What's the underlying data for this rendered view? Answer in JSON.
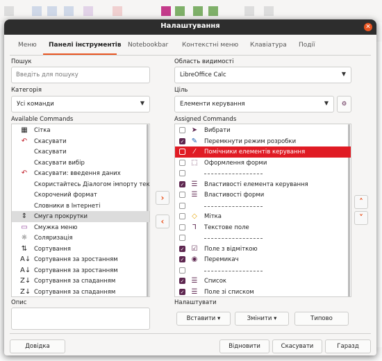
{
  "dialog": {
    "title": "Налаштування",
    "close_icon": "close-icon"
  },
  "tabs": [
    {
      "label": "Меню"
    },
    {
      "label": "Панелі інструментів"
    },
    {
      "label": "Notebookbar"
    },
    {
      "label": "Контекстні меню"
    },
    {
      "label": "Клавіатура"
    },
    {
      "label": "Події"
    }
  ],
  "left": {
    "search_label": "Пошук",
    "search_placeholder": "Введіть для пошуку",
    "category_label": "Категорія",
    "category_value": "Усі команди",
    "available_label": "Available Commands",
    "commands": [
      {
        "icon": "grid-icon",
        "glyph": "▦",
        "label": "Сітка"
      },
      {
        "icon": "undo-icon",
        "glyph": "↶",
        "label": "Скасувати"
      },
      {
        "icon": "",
        "glyph": "",
        "label": "Скасувати"
      },
      {
        "icon": "",
        "glyph": "",
        "label": "Скасувати вибір"
      },
      {
        "icon": "undo-icon",
        "glyph": "↶",
        "label": "Скасувати: введення даних"
      },
      {
        "icon": "",
        "glyph": "",
        "label": "Скористайтесь Діалогом імпорту тексту"
      },
      {
        "icon": "",
        "glyph": "",
        "label": "Скорочений формат"
      },
      {
        "icon": "",
        "glyph": "",
        "label": "Словники в Інтернеті"
      },
      {
        "icon": "scrollbar-icon",
        "glyph": "⇕",
        "label": "Смуга прокрутки"
      },
      {
        "icon": "menubar-icon",
        "glyph": "▭",
        "label": "Смужка меню"
      },
      {
        "icon": "solarize-icon",
        "glyph": "☼",
        "label": "Соляризація"
      },
      {
        "icon": "sort-icon",
        "glyph": "⇅",
        "label": "Сортування"
      },
      {
        "icon": "sort-ascending-icon",
        "glyph": "A↓",
        "label": "Сортування за зростанням"
      },
      {
        "icon": "sort-ascending-icon",
        "glyph": "A↓",
        "label": "Сортування за зростанням"
      },
      {
        "icon": "sort-descending-icon",
        "glyph": "Z↓",
        "label": "Сортування за спаданням"
      },
      {
        "icon": "sort-descending-icon",
        "glyph": "Z↓",
        "label": "Сортування за спаданням"
      }
    ],
    "description_label": "Опис"
  },
  "right": {
    "scope_label": "Область видимості",
    "scope_value": "LibreOffice Calc",
    "target_label": "Ціль",
    "target_value": "Елементи керування",
    "assigned_label": "Assigned Commands",
    "commands": [
      {
        "checked": false,
        "icon": "pointer-icon",
        "glyph": "➤",
        "label": "Вибрати",
        "type": "item"
      },
      {
        "checked": true,
        "icon": "design-mode-icon",
        "glyph": "✎",
        "label": "Перемкнути режим розробки",
        "type": "item"
      },
      {
        "checked": false,
        "icon": "wand-icon",
        "glyph": "⁄",
        "label": "Помічники елементів керування",
        "type": "item",
        "highlight": true
      },
      {
        "checked": false,
        "icon": "form-design-icon",
        "glyph": "⬚",
        "label": "Оформлення форми",
        "type": "item"
      },
      {
        "checked": false,
        "icon": "",
        "glyph": "",
        "label": "",
        "type": "sep"
      },
      {
        "checked": true,
        "icon": "control-properties-icon",
        "glyph": "☰",
        "label": "Властивості елемента керування",
        "type": "item"
      },
      {
        "checked": false,
        "icon": "form-properties-icon",
        "glyph": "☰",
        "label": "Властивості форми",
        "type": "item"
      },
      {
        "checked": false,
        "icon": "",
        "glyph": "",
        "label": "",
        "type": "sep"
      },
      {
        "checked": false,
        "icon": "label-icon",
        "glyph": "◇",
        "label": "Мітка",
        "type": "item"
      },
      {
        "checked": false,
        "icon": "textbox-icon",
        "glyph": "Ꞁ",
        "label": "Текстове поле",
        "type": "item"
      },
      {
        "checked": false,
        "icon": "",
        "glyph": "",
        "label": "",
        "type": "sep"
      },
      {
        "checked": true,
        "icon": "checkbox-icon",
        "glyph": "☑",
        "label": "Поле з відміткою",
        "type": "item"
      },
      {
        "checked": true,
        "icon": "radio-icon",
        "glyph": "◉",
        "label": "Перемикач",
        "type": "item"
      },
      {
        "checked": false,
        "icon": "",
        "glyph": "",
        "label": "",
        "type": "sep"
      },
      {
        "checked": true,
        "icon": "listbox-icon",
        "glyph": "☰",
        "label": "Список",
        "type": "item"
      },
      {
        "checked": true,
        "icon": "combobox-icon",
        "glyph": "☰",
        "label": "Поле зі списком",
        "type": "item"
      }
    ],
    "customize_label": "Налаштувати",
    "insert_label": "Вставити",
    "modify_label": "Змінити",
    "defaults_label": "Типово"
  },
  "footer": {
    "help_label": "Довідка",
    "reset_label": "Відновити",
    "cancel_label": "Скасувати",
    "ok_label": "Гаразд"
  },
  "colors": {
    "accent": "#e95420",
    "highlight": "#e01b24",
    "checkbox": "#5e2750"
  }
}
